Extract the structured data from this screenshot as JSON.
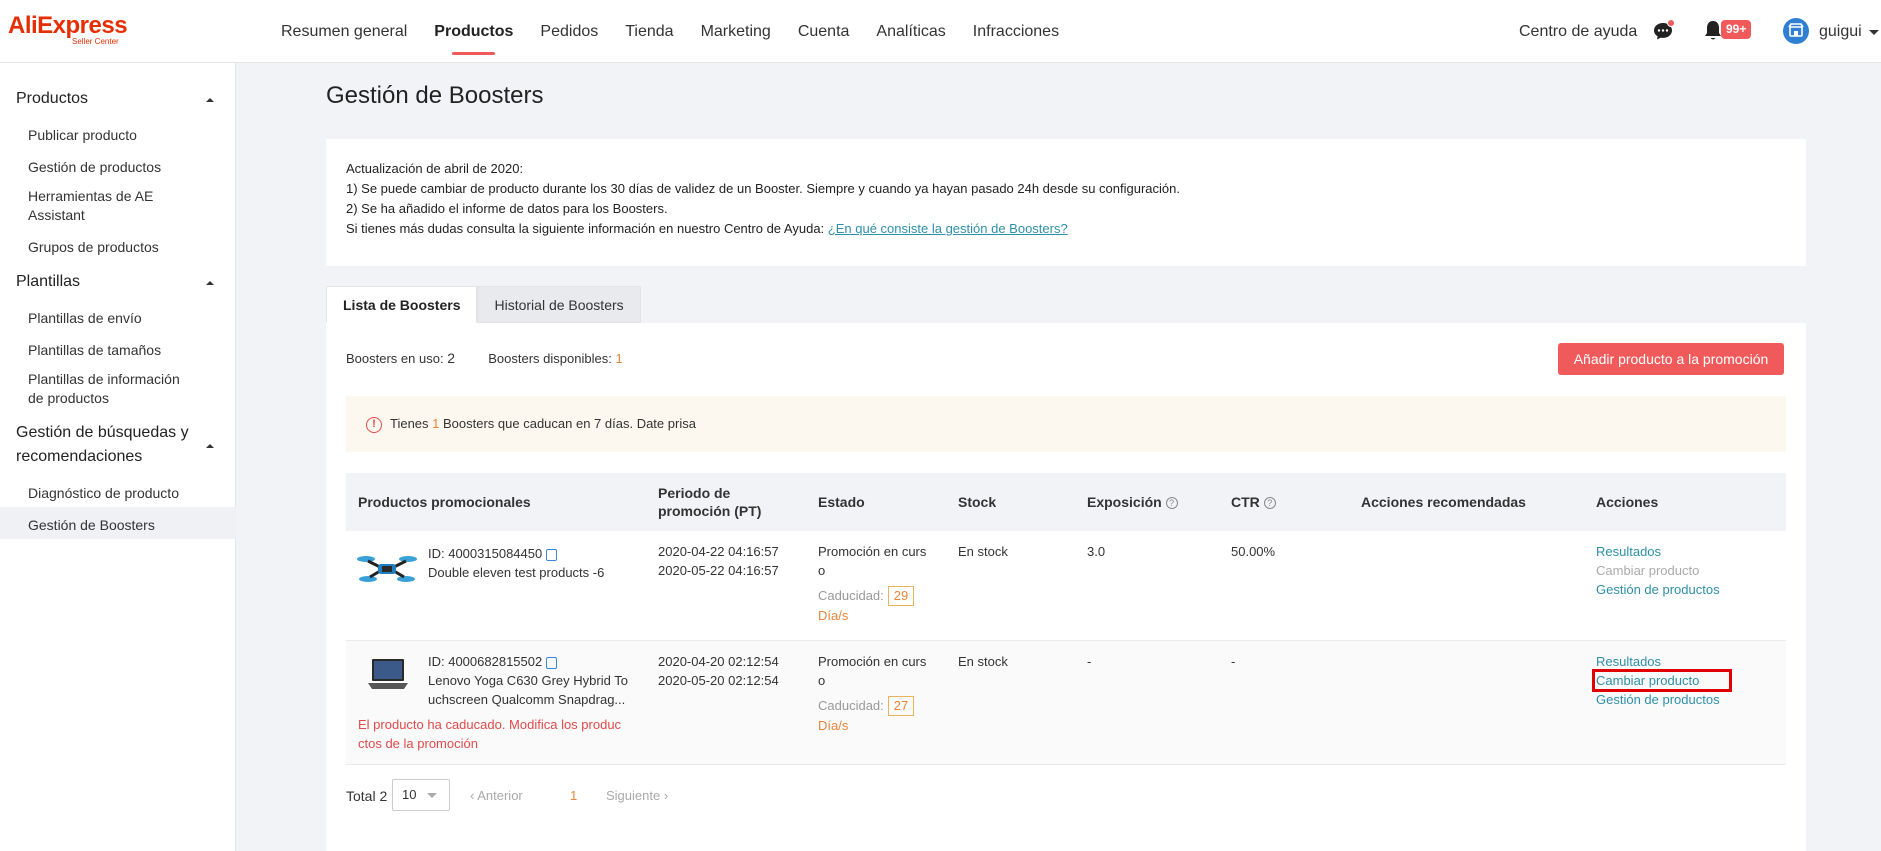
{
  "header": {
    "logo_text": "AliExpress",
    "logo_sub": "Seller Center",
    "nav": [
      "Resumen general",
      "Productos",
      "Pedidos",
      "Tienda",
      "Marketing",
      "Cuenta",
      "Analíticas",
      "Infracciones"
    ],
    "active_nav": "Productos",
    "help": "Centro de ayuda",
    "notification_badge": "99+",
    "user": "guigui"
  },
  "sidebar": {
    "groups": [
      {
        "title": "Productos",
        "items": [
          "Publicar producto",
          "Gestión de productos",
          "Herramientas de AE Assistant",
          "Grupos de productos"
        ]
      },
      {
        "title": "Plantillas",
        "items": [
          "Plantillas de envío",
          "Plantillas de tamaños",
          "Plantillas de información de productos"
        ]
      },
      {
        "title": "Gestión de búsquedas y recomendaciones",
        "items": [
          "Diagnóstico de producto",
          "Gestión de Boosters"
        ]
      }
    ],
    "active_item": "Gestión de Boosters"
  },
  "page": {
    "title": "Gestión de Boosters",
    "notice": {
      "line1": "Actualización de abril de 2020:",
      "line2": "1) Se puede cambiar de producto durante los 30 días de validez de un Booster. Siempre y cuando ya hayan pasado 24h desde su configuración.",
      "line3": "2) Se ha añadido el informe de datos para los Boosters.",
      "line4": "Si tienes más dudas consulta la siguiente información en nuestro Centro de Ayuda: ",
      "link": "¿En qué consiste la gestión de Boosters?"
    },
    "tabs": [
      "Lista de Boosters",
      "Historial de Boosters"
    ],
    "in_use_label": "Boosters en uso:",
    "in_use_value": "2",
    "available_label": "Boosters disponibles:",
    "available_value": "1",
    "add_button": "Añadir producto a la promoción",
    "alert": {
      "pre": "Tienes ",
      "count": "1",
      "post": " Boosters que caducan en 7 días. Date prisa"
    },
    "columns": [
      "Productos promocionales",
      "Periodo de promoción (PT)",
      "Estado",
      "Stock",
      "Exposición",
      "CTR",
      "Acciones recomendadas",
      "Acciones"
    ],
    "rows": [
      {
        "id": "ID: 4000315084450",
        "name": "Double eleven test products -6",
        "name2": "",
        "start": "2020-04-22 04:16:57",
        "end": "2020-05-22 04:16:57",
        "status_a": "Promoción en curs",
        "status_b": "o",
        "expiry_label": "Caducidad:",
        "expiry_days": "29",
        "days_unit": "Día/s",
        "stock": "En stock",
        "exposure": "3.0",
        "ctr": "50.00%",
        "actions": [
          "Resultados",
          "Cambiar producto",
          "Gestión de productos"
        ],
        "expired_msg_a": "",
        "expired_msg_b": ""
      },
      {
        "id": "ID: 4000682815502",
        "name": "Lenovo Yoga C630 Grey Hybrid To",
        "name2": "uchscreen Qualcomm Snapdrag...",
        "start": "2020-04-20 02:12:54",
        "end": "2020-05-20 02:12:54",
        "status_a": "Promoción en curs",
        "status_b": "o",
        "expiry_label": "Caducidad:",
        "expiry_days": "27",
        "days_unit": "Día/s",
        "stock": "En stock",
        "exposure": "-",
        "ctr": "-",
        "actions": [
          "Resultados",
          "Cambiar producto",
          "Gestión de productos"
        ],
        "expired_msg_a": "El producto ha caducado. Modifica los produc",
        "expired_msg_b": "ctos de la promoción"
      }
    ],
    "pager": {
      "total": "Total 2",
      "page_size": "10",
      "prev": "Anterior",
      "current": "1",
      "next": "Siguiente"
    }
  },
  "colors": {
    "accent": "#f05a5a",
    "link": "#2e8fa8",
    "warning": "#e8853a",
    "error": "#e04a4a"
  }
}
